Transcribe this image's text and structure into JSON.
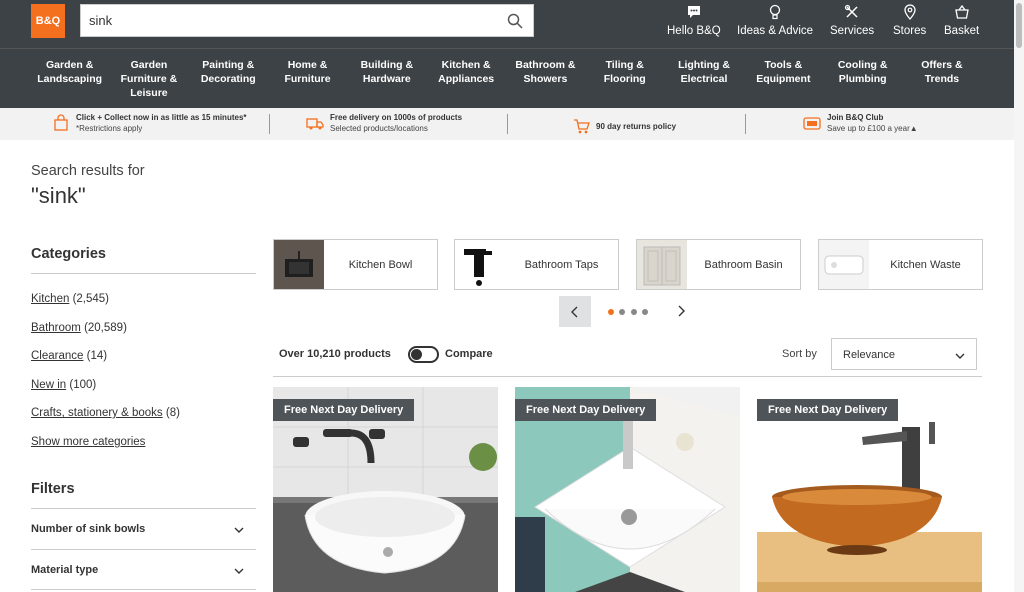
{
  "brand": {
    "logo_text": "B&Q",
    "accent": "#f46f1e",
    "header_bg": "#3c4246"
  },
  "search": {
    "value": "sink",
    "icon": "search-icon"
  },
  "top_nav": [
    {
      "label": "Hello B&Q",
      "icon": "chat-icon"
    },
    {
      "label": "Ideas & Advice",
      "icon": "bulb-icon"
    },
    {
      "label": "Services",
      "icon": "tools-icon"
    },
    {
      "label": "Stores",
      "icon": "location-pin-icon"
    },
    {
      "label": "Basket",
      "icon": "basket-icon"
    }
  ],
  "categories_nav": [
    {
      "label": "Garden &\nLandscaping"
    },
    {
      "label": "Garden\nFurniture &\nLeisure"
    },
    {
      "label": "Painting &\nDecorating"
    },
    {
      "label": "Home &\nFurniture"
    },
    {
      "label": "Building &\nHardware"
    },
    {
      "label": "Kitchen &\nAppliances"
    },
    {
      "label": "Bathroom &\nShowers"
    },
    {
      "label": "Tiling &\nFlooring"
    },
    {
      "label": "Lighting &\nElectrical"
    },
    {
      "label": "Tools &\nEquipment"
    },
    {
      "label": "Cooling &\nPlumbing"
    },
    {
      "label": "Offers &\nTrends"
    }
  ],
  "promos": [
    {
      "line1": "Click + Collect now in as little as 15 minutes*",
      "line2": "*Restrictions apply",
      "icon": "bag-icon"
    },
    {
      "line1": "Free delivery on 1000s of products",
      "line2": "Selected products/locations",
      "icon": "truck-icon"
    },
    {
      "line1": "90 day returns policy",
      "line2": "",
      "icon": "trolley-icon"
    },
    {
      "line1": "Join B&Q Club",
      "line2": "Save up to £100 a year▲",
      "icon": "club-card-icon"
    }
  ],
  "results": {
    "heading": "Search results for",
    "query": "\"sink\""
  },
  "sidebar": {
    "categories_title": "Categories",
    "categories": [
      {
        "name": "Kitchen",
        "count": "(2,545)"
      },
      {
        "name": "Bathroom",
        "count": "(20,589)"
      },
      {
        "name": "Clearance",
        "count": "(14)"
      },
      {
        "name": "New in",
        "count": "(100)"
      },
      {
        "name": "Crafts, stationery & books",
        "count": "(8)"
      }
    ],
    "show_more": "Show more categories",
    "filters_title": "Filters",
    "filters": [
      {
        "label": "Number of sink bowls"
      },
      {
        "label": "Material type"
      }
    ]
  },
  "tiles": [
    {
      "label": "Kitchen Bowl"
    },
    {
      "label": "Bathroom Taps"
    },
    {
      "label": "Bathroom Basin"
    },
    {
      "label": "Kitchen Waste"
    }
  ],
  "carousel": {
    "page": 1,
    "pages": 4
  },
  "toolbar": {
    "count": "Over 10,210 products",
    "compare": "Compare",
    "sort_label": "Sort by",
    "sort_value": "Relevance"
  },
  "products": [
    {
      "badge": "Free Next Day Delivery"
    },
    {
      "badge": "Free Next Day Delivery"
    },
    {
      "badge": "Free Next Day Delivery"
    }
  ]
}
